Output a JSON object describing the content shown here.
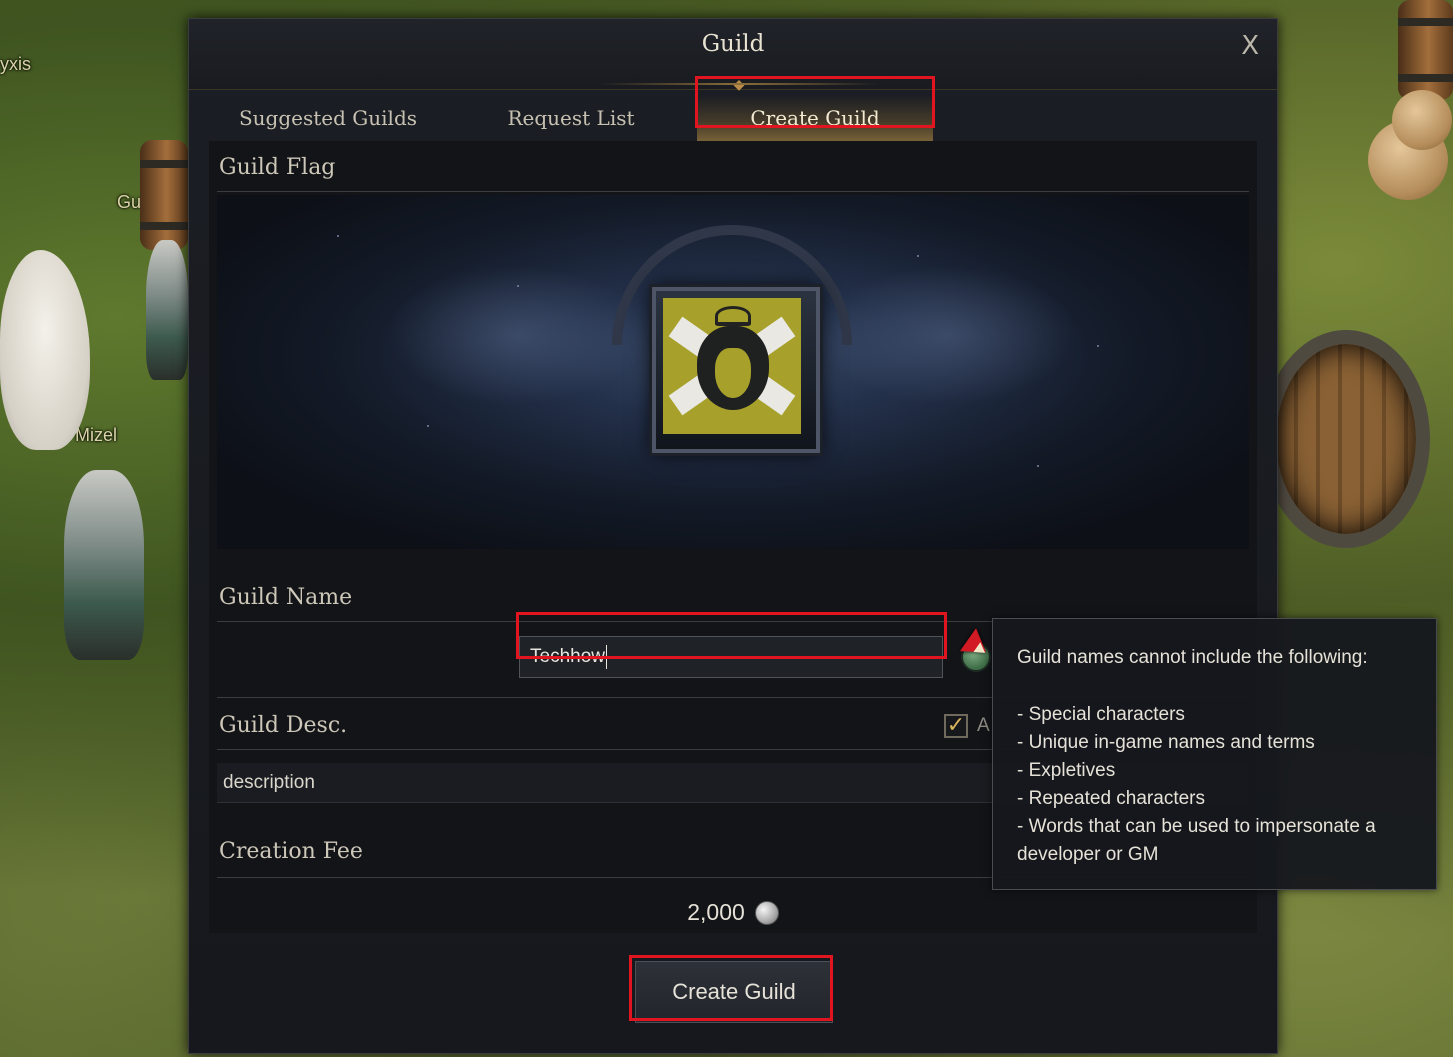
{
  "world": {
    "label_1": "yxis",
    "label_2": "Guard N",
    "label_3": "Guard Mizel"
  },
  "dialog": {
    "title": "Guild",
    "close_label": "X"
  },
  "tabs": [
    {
      "label": "Suggested Guilds",
      "active": false
    },
    {
      "label": "Request List",
      "active": false
    },
    {
      "label": "Create Guild",
      "active": true
    }
  ],
  "sections": {
    "flag_title": "Guild Flag",
    "name_title": "Guild Name",
    "desc_title": "Guild Desc.",
    "fee_title": "Creation Fee"
  },
  "guild_name": {
    "value": "Techhow"
  },
  "suggested_option": {
    "checked": true,
    "label": "A"
  },
  "guild_desc": {
    "value": "description"
  },
  "fee": {
    "amount": "2,000",
    "currency_icon": "silver-coin-icon"
  },
  "create_button": {
    "label": "Create Guild"
  },
  "tooltip": {
    "heading": "Guild names cannot include the following:",
    "items": [
      "Special characters",
      "Unique in-game names and terms",
      "Expletives",
      "Repeated characters",
      "Words that can be used to impersonate a developer or GM"
    ]
  },
  "colors": {
    "highlight": "#e0151f",
    "accent_gold": "#c89a45",
    "flag_field": "#a7a02a"
  }
}
